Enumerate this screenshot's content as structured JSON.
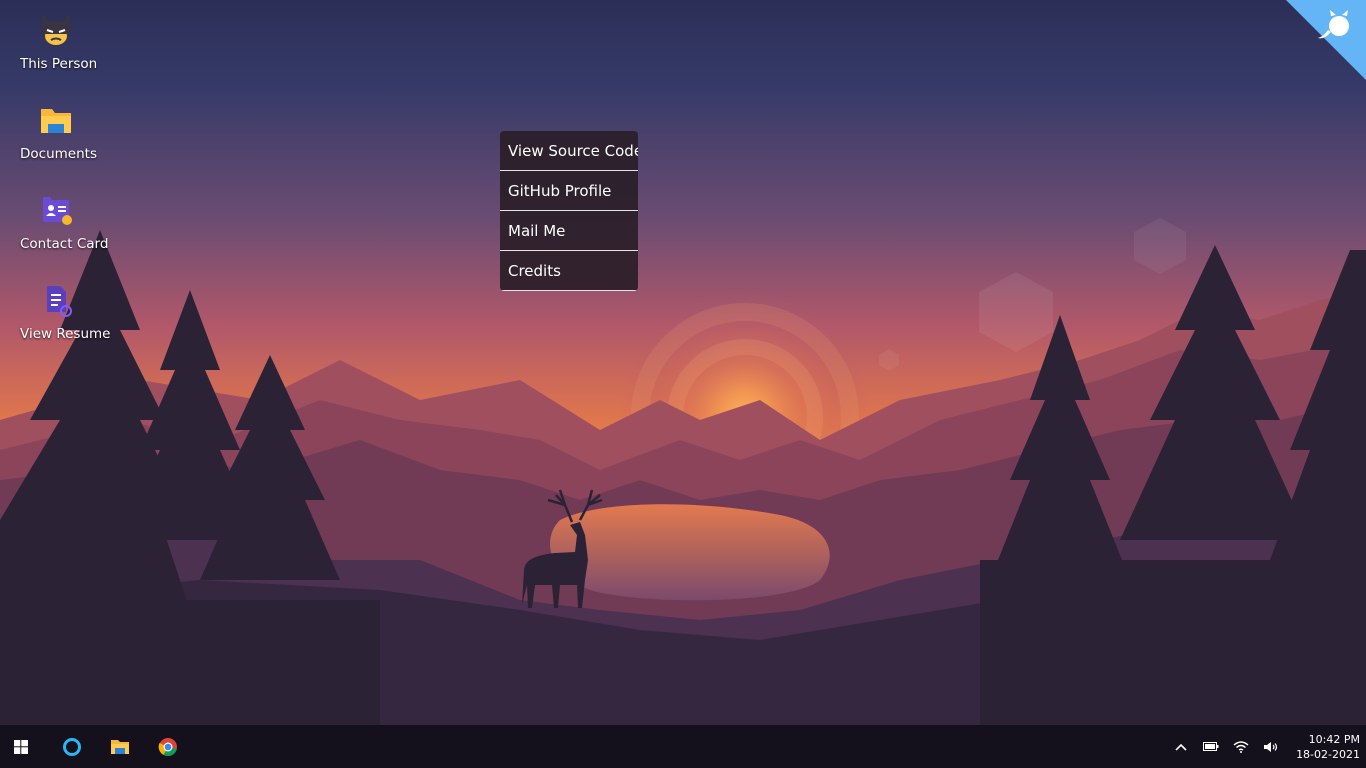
{
  "desktop": {
    "icons": [
      {
        "label": "This Person",
        "icon": "batman-avatar-icon"
      },
      {
        "label": "Documents",
        "icon": "folder-icon"
      },
      {
        "label": "Contact Card",
        "icon": "contact-card-icon"
      },
      {
        "label": "View Resume",
        "icon": "resume-file-icon"
      }
    ]
  },
  "context_menu": {
    "items": [
      "View Source Code",
      "GitHub Profile",
      "Mail Me",
      "Credits"
    ]
  },
  "corner_ribbon": {
    "icon": "github-octocat-icon",
    "color": "#64b5f6"
  },
  "taskbar": {
    "start_icon": "windows-logo-icon",
    "pinned": [
      {
        "icon": "cortana-icon"
      },
      {
        "icon": "file-explorer-icon"
      },
      {
        "icon": "chrome-icon"
      }
    ],
    "tray": {
      "icons": [
        "show-hidden-icons-chevron",
        "battery-icon",
        "wifi-icon",
        "volume-icon"
      ],
      "time": "10:42 PM",
      "date": "18-02-2021"
    }
  },
  "colors": {
    "taskbar_bg": "#14111c",
    "menu_bg": "#2a1e28",
    "sun": "#ffffff",
    "sky_top": "#2e3361",
    "sky_horizon": "#e9824a"
  }
}
